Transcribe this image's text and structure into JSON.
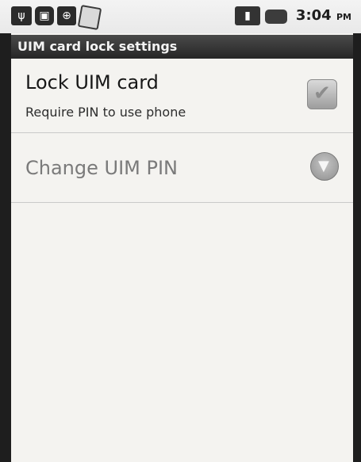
{
  "status_bar": {
    "time": "3:04",
    "ampm": "PM",
    "icons": [
      "usb-icon",
      "sd-card-icon",
      "debug-icon",
      "document-icon",
      "signal-icon",
      "battery-icon"
    ]
  },
  "title_bar": {
    "title": "UIM card lock settings"
  },
  "settings": {
    "lock_uim": {
      "title": "Lock UIM card",
      "summary": "Require PIN to use phone",
      "checked": true
    },
    "change_pin": {
      "title": "Change UIM PIN",
      "enabled": false
    }
  }
}
